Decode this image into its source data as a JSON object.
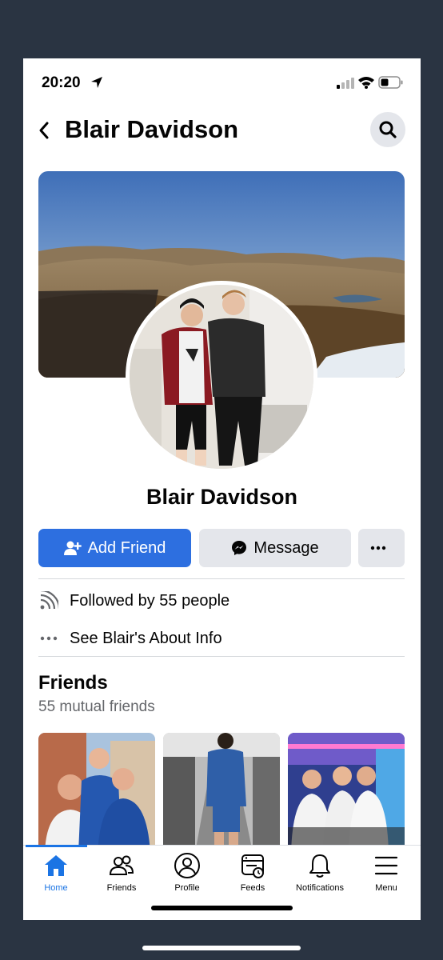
{
  "status_bar": {
    "time": "20:20"
  },
  "header": {
    "title": "Blair Davidson"
  },
  "profile": {
    "name": "Blair Davidson"
  },
  "actions": {
    "add_friend_label": "Add Friend",
    "message_label": "Message"
  },
  "info": {
    "followed_by": "Followed by 55 people",
    "about_link": "See Blair's About Info"
  },
  "friends": {
    "title": "Friends",
    "mutual": "55 mutual friends"
  },
  "nav": {
    "items": [
      {
        "label": "Home",
        "icon": "home-icon",
        "active": true
      },
      {
        "label": "Friends",
        "icon": "friends-icon",
        "active": false
      },
      {
        "label": "Profile",
        "icon": "profile-icon",
        "active": false
      },
      {
        "label": "Feeds",
        "icon": "feeds-icon",
        "active": false
      },
      {
        "label": "Notifications",
        "icon": "bell-icon",
        "active": false
      },
      {
        "label": "Menu",
        "icon": "menu-icon",
        "active": false
      }
    ]
  },
  "colors": {
    "accent": "#1b74e4",
    "add_friend_bg": "#2d6fe0",
    "button_gray": "#e4e6eb",
    "frame_bg": "#2a3442"
  }
}
